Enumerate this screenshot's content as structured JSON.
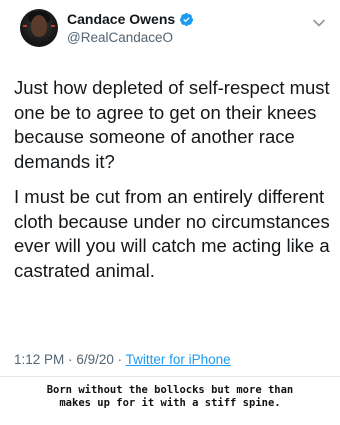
{
  "header": {
    "display_name": "Candace Owens",
    "handle": "@RealCandaceO",
    "avatar_icon": "profile-photo",
    "verified_icon": "verified-badge-icon",
    "menu_icon": "chevron-down-icon"
  },
  "tweet": {
    "paragraphs": [
      "Just how depleted of self-respect must one be to agree to get on their knees because someone of another race demands it?",
      "I must be cut from an entirely different cloth because under no circumstances ever will you will catch me acting like a castrated animal."
    ],
    "time": "1:12 PM",
    "date": "6/9/20",
    "separator": "·",
    "source": "Twitter for iPhone"
  },
  "caption": {
    "line1": "Born without the bollocks but more than",
    "line2": "makes up for it with a stiff spine."
  },
  "colors": {
    "text": "#14171a",
    "secondary": "#536471",
    "link": "#1d9bf0",
    "verified": "#1d9bf0"
  }
}
